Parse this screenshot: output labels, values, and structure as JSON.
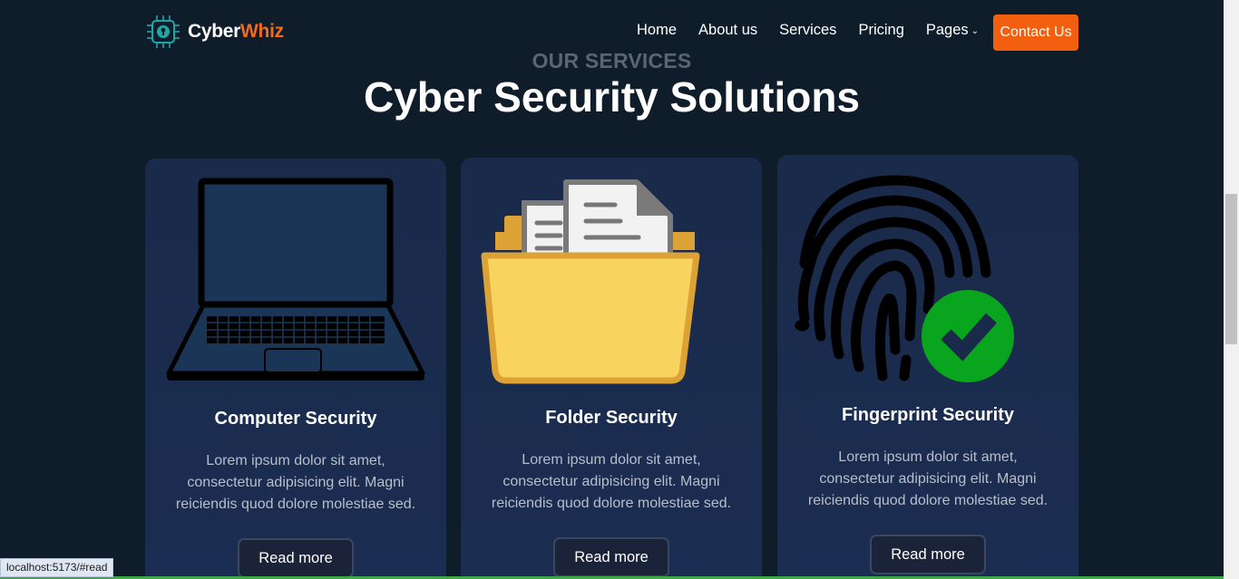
{
  "brand": {
    "name_main": "Cyber",
    "name_accent": "Whiz",
    "logo_icon": "circuit-lock-icon",
    "accent_color": "#f26a1b"
  },
  "nav": {
    "links": [
      "Home",
      "About us",
      "Services",
      "Pricing",
      "Pages"
    ],
    "pages_dropdown_icon": "chevron-down-icon",
    "contact_label": "Contact Us",
    "contact_color": "#f2600f"
  },
  "hero": {
    "eyebrow": "OUR SERVICES",
    "title": "Cyber Security Solutions"
  },
  "cards": [
    {
      "icon": "laptop-icon",
      "title": "Computer Security",
      "description": "Lorem ipsum dolor sit amet, consectetur adipisicing elit. Magni reiciendis quod dolore molestiae sed.",
      "button": "Read more"
    },
    {
      "icon": "folder-documents-icon",
      "title": "Folder Security",
      "description": "Lorem ipsum dolor sit amet, consectetur adipisicing elit. Magni reiciendis quod dolore molestiae sed.",
      "button": "Read more"
    },
    {
      "icon": "fingerprint-check-icon",
      "title": "Fingerprint Security",
      "description": "Lorem ipsum dolor sit amet, consectetur adipisicing elit. Magni reiciendis quod dolore molestiae sed.",
      "button": "Read more"
    }
  ],
  "status_bar": {
    "url": "localhost:5173/#read"
  },
  "colors": {
    "background": "#0f1d2b",
    "card": "#1a2a4a",
    "check_green": "#0aa51e"
  }
}
